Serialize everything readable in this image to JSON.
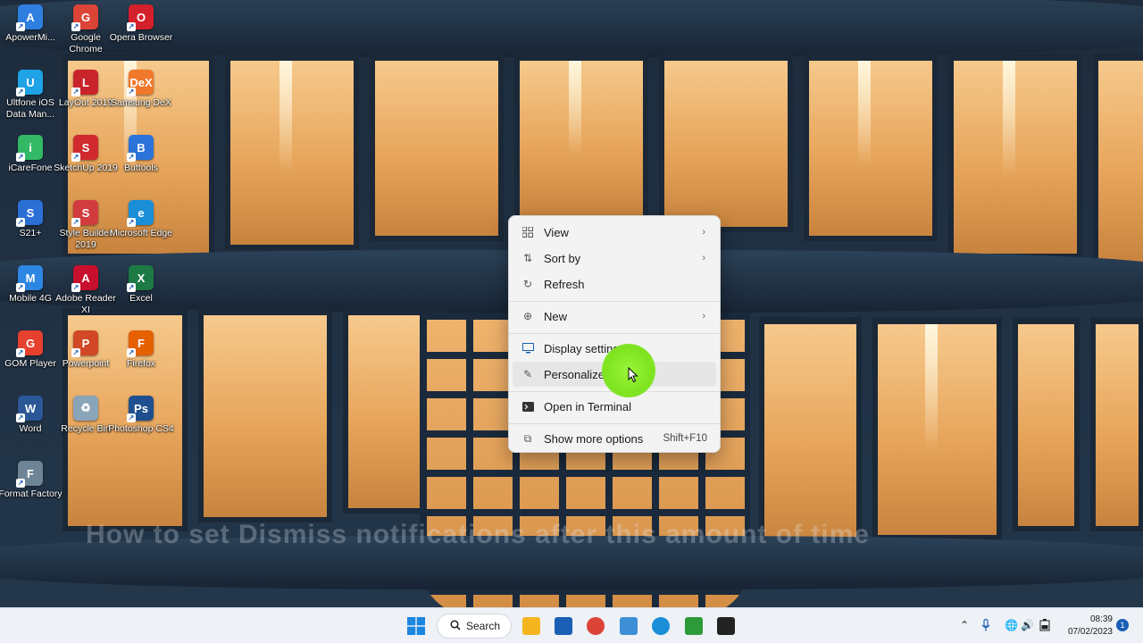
{
  "desktop": {
    "icons": [
      {
        "label": "ApowerMi...",
        "color": "#2f7fe0",
        "glyph": "A"
      },
      {
        "label": "Google Chrome",
        "color": "#db4437",
        "glyph": "G"
      },
      {
        "label": "Opera Browser",
        "color": "#d4202b",
        "glyph": "O"
      },
      {
        "label": "Ultfone iOS Data Man...",
        "color": "#1fa3e6",
        "glyph": "U"
      },
      {
        "label": "LayOut 2019",
        "color": "#c9242b",
        "glyph": "L"
      },
      {
        "label": "Samsung DeX",
        "color": "#f1782b",
        "glyph": "DeX"
      },
      {
        "label": "iCareFone",
        "color": "#33b865",
        "glyph": "i"
      },
      {
        "label": "SketchUp 2019",
        "color": "#d02a2f",
        "glyph": "S"
      },
      {
        "label": "Buttools",
        "color": "#2b73d8",
        "glyph": "B"
      },
      {
        "label": "S21+",
        "color": "#2a6fd6",
        "glyph": "S"
      },
      {
        "label": "Style Builder 2019",
        "color": "#d23c3f",
        "glyph": "S"
      },
      {
        "label": "Microsoft Edge",
        "color": "#1a8fd8",
        "glyph": "e"
      },
      {
        "label": "Mobile 4G",
        "color": "#2d86e3",
        "glyph": "M"
      },
      {
        "label": "Adobe Reader XI",
        "color": "#c8102e",
        "glyph": "A"
      },
      {
        "label": "Excel",
        "color": "#1d7a45",
        "glyph": "X"
      },
      {
        "label": "GOM Player",
        "color": "#e6402f",
        "glyph": "G"
      },
      {
        "label": "Powerpoint",
        "color": "#d24726",
        "glyph": "P"
      },
      {
        "label": "Firefox",
        "color": "#e66000",
        "glyph": "F"
      },
      {
        "label": "Word",
        "color": "#2b5797",
        "glyph": "W"
      },
      {
        "label": "Recycle Bin",
        "color": "#8aa4b8",
        "glyph": "♻"
      },
      {
        "label": "Photoshop CS4",
        "color": "#1f4f8f",
        "glyph": "Ps"
      },
      {
        "label": "Format Factory",
        "color": "#6d8596",
        "glyph": "F"
      }
    ]
  },
  "overlay_caption": "How to set Dismiss notifications after this amount of time",
  "context_menu": {
    "items": [
      {
        "label": "View",
        "icon": "grid-icon",
        "submenu": true
      },
      {
        "label": "Sort by",
        "icon": "sort-icon",
        "submenu": true
      },
      {
        "label": "Refresh",
        "icon": "refresh-icon"
      },
      {
        "label": "New",
        "icon": "plus-circle-icon",
        "submenu": true
      },
      {
        "label": "Display settings",
        "icon": "display-icon"
      },
      {
        "label": "Personalize",
        "icon": "pencil-icon",
        "hovered": true
      },
      {
        "label": "Open in Terminal",
        "icon": "terminal-icon"
      },
      {
        "label": "Show more options",
        "icon": "external-icon",
        "shortcut": "Shift+F10"
      }
    ]
  },
  "taskbar": {
    "search_label": "Search",
    "pinned": [
      {
        "name": "file-explorer",
        "color": "#f5b520"
      },
      {
        "name": "microsoft-store",
        "color": "#1a5fb4"
      },
      {
        "name": "chrome",
        "color": "#db4437"
      },
      {
        "name": "notepad",
        "color": "#3f8fd6"
      },
      {
        "name": "edge",
        "color": "#1a8fd8"
      },
      {
        "name": "camtasia-green",
        "color": "#2e9b3a"
      },
      {
        "name": "camtasia",
        "color": "#222222"
      }
    ],
    "clock_time": "08:39",
    "clock_date": "07/02/2023",
    "notification_count": "1"
  }
}
